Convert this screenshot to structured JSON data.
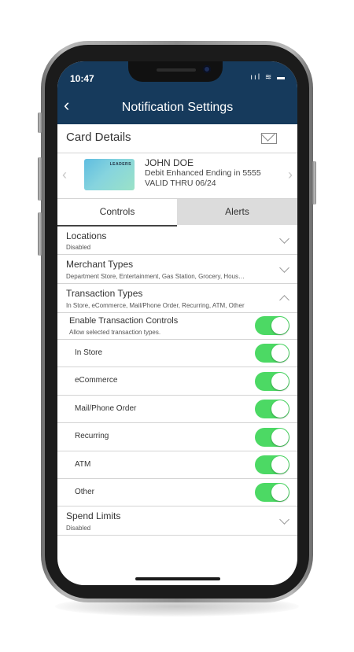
{
  "status_bar": {
    "time": "10:47",
    "icons": "ııl ≋ ▬"
  },
  "header": {
    "title": "Notification Settings",
    "back_icon": "chevron-left-icon"
  },
  "card_details": {
    "title": "Card Details",
    "card_logo": "LEADERS",
    "holder_name": "JOHN DOE",
    "card_desc": "Debit Enhanced Ending in 5555",
    "valid": "VALID THRU 06/24"
  },
  "tabs": [
    {
      "label": "Controls",
      "active": true
    },
    {
      "label": "Alerts",
      "active": false
    }
  ],
  "sections": {
    "locations": {
      "label": "Locations",
      "sub": "Disabled"
    },
    "merchant": {
      "label": "Merchant Types",
      "sub": "Department Store, Entertainment, Gas Station, Grocery, Hous…"
    },
    "transaction": {
      "label": "Transaction Types",
      "sub": "In Store, eCommerce, Mail/Phone Order, Recurring, ATM, Other"
    },
    "spend": {
      "label": "Spend Limits",
      "sub": "Disabled"
    }
  },
  "enable": {
    "label": "Enable Transaction Controls",
    "sub": "Allow selected transaction types.",
    "on": true
  },
  "transaction_types": [
    {
      "label": "In Store",
      "on": true
    },
    {
      "label": "eCommerce",
      "on": true
    },
    {
      "label": "Mail/Phone Order",
      "on": true
    },
    {
      "label": "Recurring",
      "on": true
    },
    {
      "label": "ATM",
      "on": true
    },
    {
      "label": "Other",
      "on": true
    }
  ],
  "colors": {
    "header_bg": "#163a5c",
    "toggle_on": "#4cd964",
    "tab_inactive": "#dcdcdc"
  }
}
